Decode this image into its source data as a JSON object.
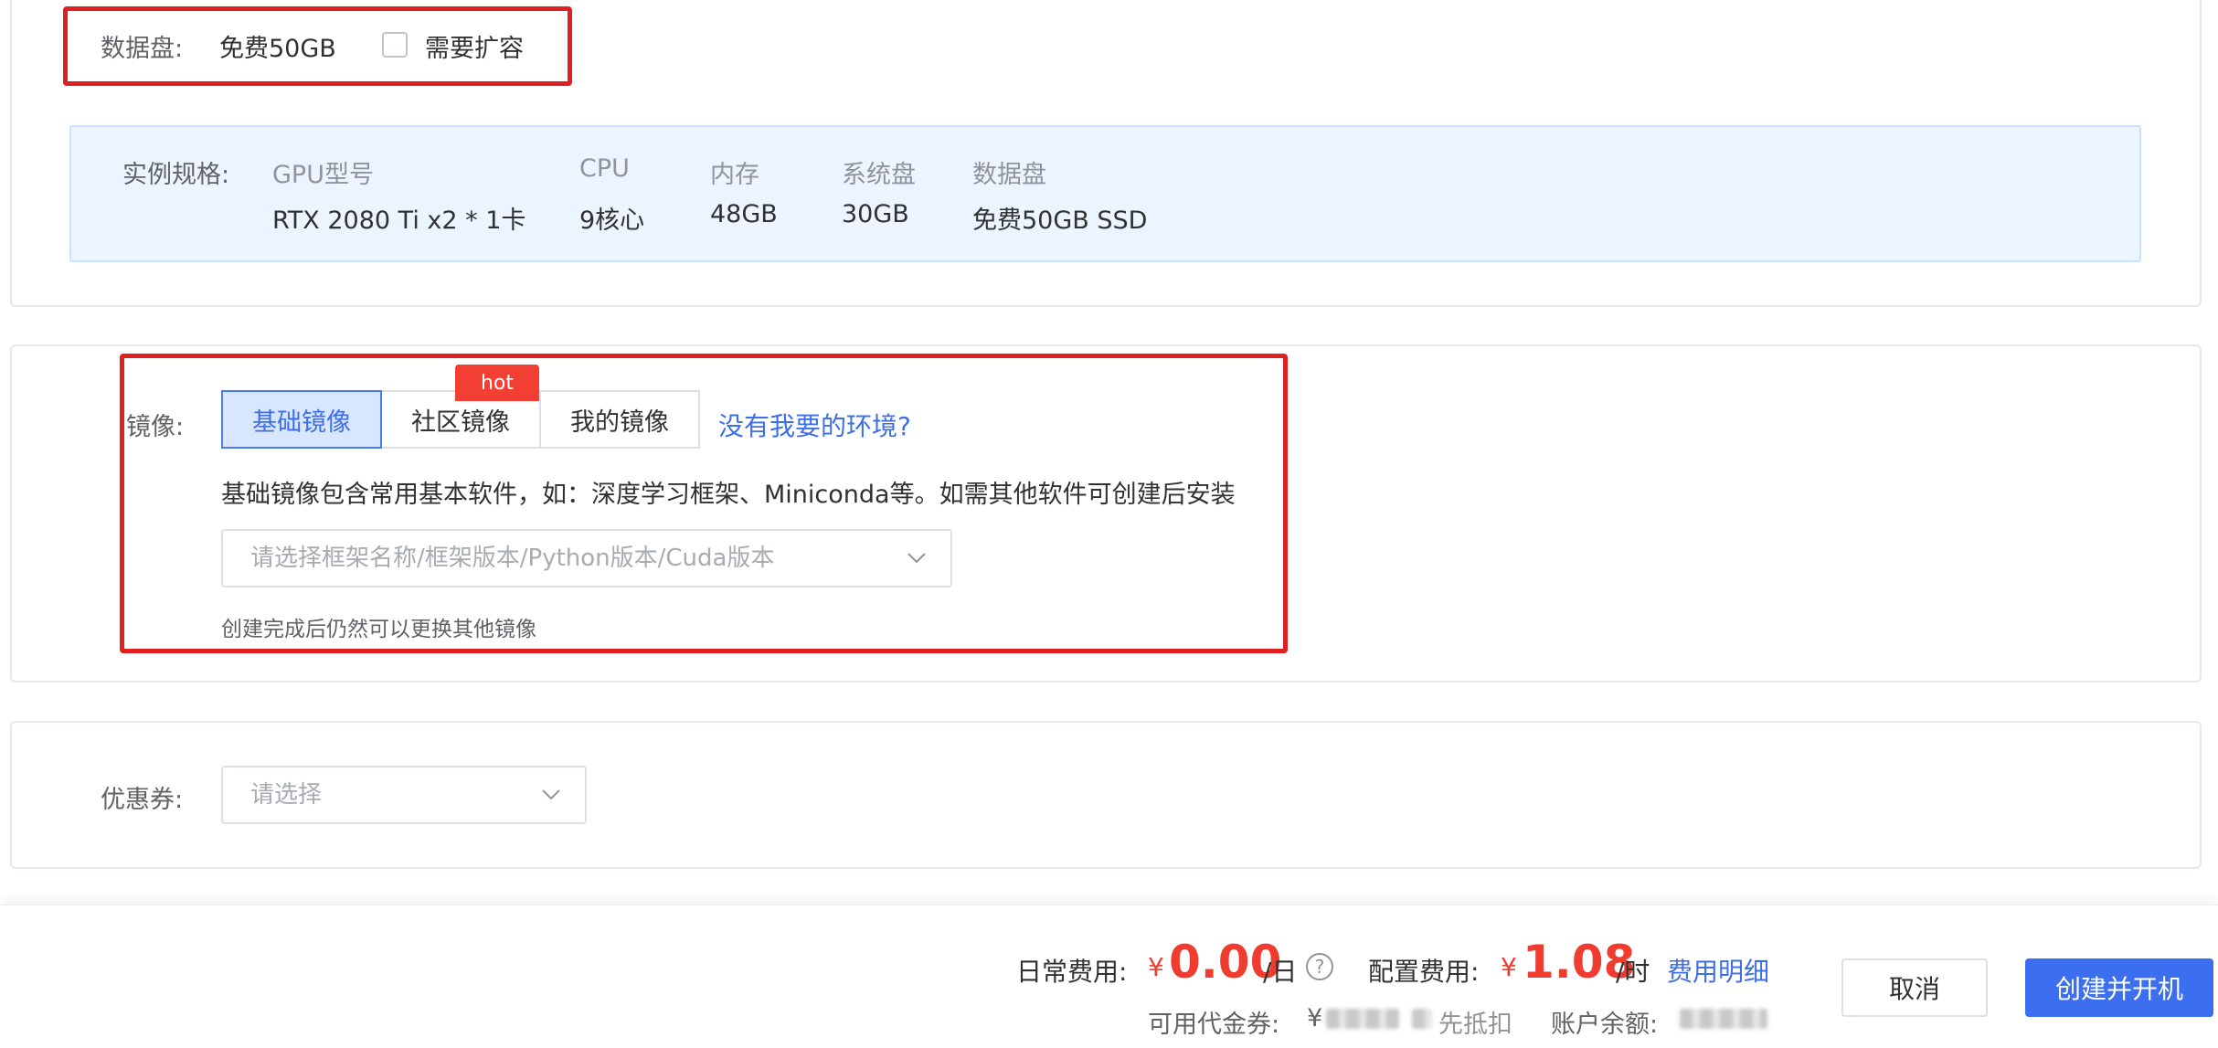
{
  "data_disk": {
    "label": "数据盘:",
    "value": "免费50GB",
    "expand_label": "需要扩容"
  },
  "spec": {
    "label": "实例规格:",
    "columns": [
      {
        "head": "GPU型号",
        "value": "RTX 2080 Ti x2 * 1卡"
      },
      {
        "head": "CPU",
        "value": "9核心"
      },
      {
        "head": "内存",
        "value": "48GB"
      },
      {
        "head": "系统盘",
        "value": "30GB"
      },
      {
        "head": "数据盘",
        "value": "免费50GB SSD"
      }
    ]
  },
  "image": {
    "label": "镜像:",
    "tabs": [
      {
        "label": "基础镜像",
        "active": true
      },
      {
        "label": "社区镜像",
        "badge": "hot"
      },
      {
        "label": "我的镜像"
      }
    ],
    "missing_env_link": "没有我要的环境?",
    "description": "基础镜像包含常用基本软件，如：深度学习框架、Miniconda等。如需其他软件可创建后安装",
    "select_placeholder": "请选择框架名称/框架版本/Python版本/Cuda版本",
    "hint": "创建完成后仍然可以更换其他镜像"
  },
  "coupon": {
    "label": "优惠券:",
    "placeholder": "请选择"
  },
  "footer": {
    "daily_fee_label": "日常费用:",
    "currency": "¥",
    "daily_fee_value": "0.00",
    "daily_fee_unit": "/日",
    "help_glyph": "?",
    "config_fee_label": "配置费用:",
    "config_fee_value": "1.08",
    "config_fee_unit": "/时",
    "fee_detail_link": "费用明细",
    "voucher_label": "可用代金券:",
    "voucher_prefix": "¥",
    "voucher_suffix": "先抵扣",
    "balance_label": "账户余额:",
    "cancel_button": "取消",
    "create_button": "创建并开机"
  },
  "colors": {
    "accent": "#3b6ff0",
    "price": "#f03c2f",
    "highlight_box": "#e02020",
    "hot_badge": "#f33f33"
  }
}
